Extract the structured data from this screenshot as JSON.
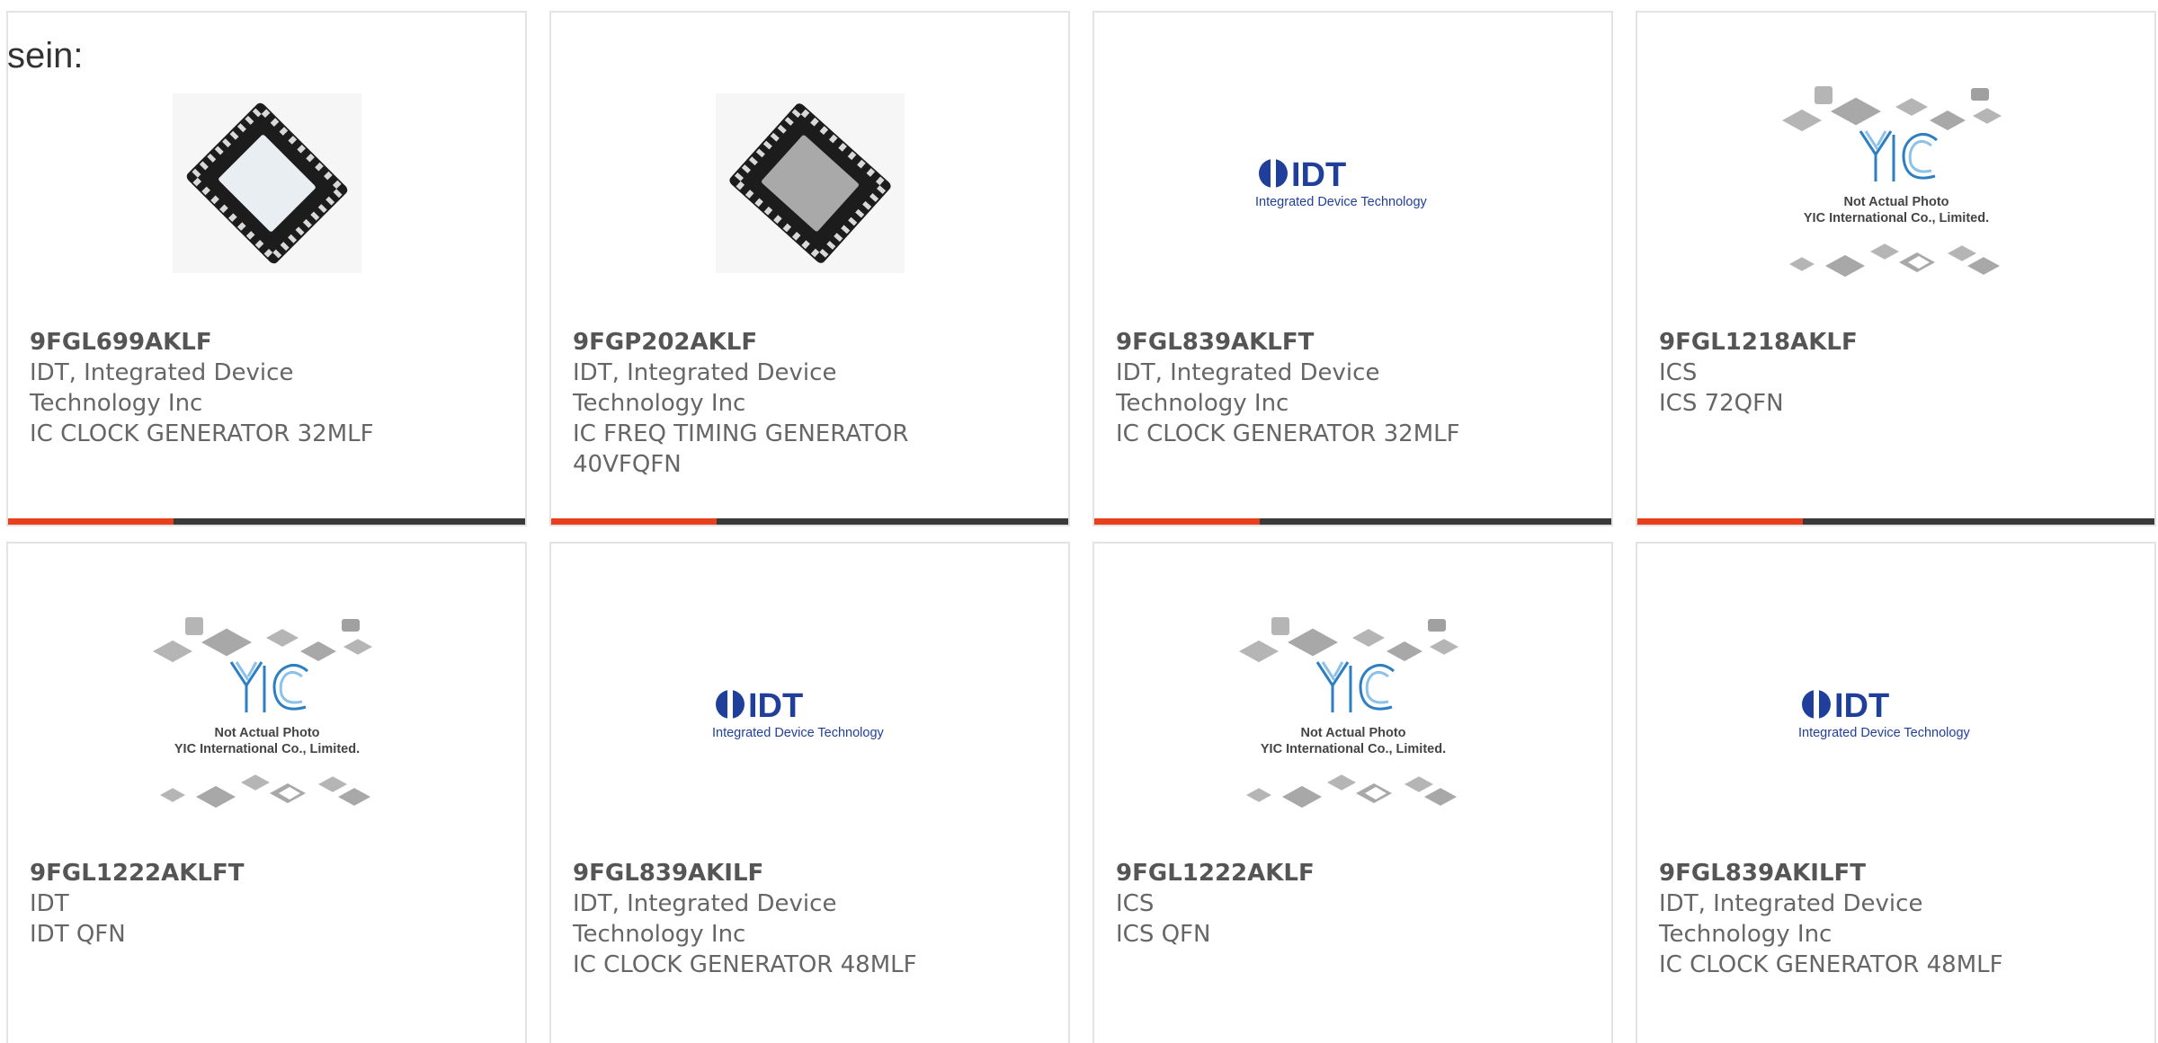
{
  "intro_text": "sein:",
  "colors": {
    "accent": "#e8401c",
    "bar_dark": "#3a3a3a",
    "card_border": "#e3e3e3",
    "idt_blue": "#1f3f9a"
  },
  "placeholder_image": {
    "line1": "Not Actual Photo",
    "line2": "YIC International Co., Limited."
  },
  "idt_logo": {
    "word": "IDT",
    "tagline": "Integrated Device Technology"
  },
  "cards": [
    {
      "image": "qfn-32-chip-photo",
      "part_number": "9FGL699AKLF",
      "manufacturer_lines": [
        "IDT, Integrated Device",
        "Technology Inc"
      ],
      "description_lines": [
        "IC CLOCK GENERATOR 32MLF"
      ],
      "hover_progress": 0.32
    },
    {
      "image": "vfqfn-40-chip-photo",
      "part_number": "9FGP202AKLF",
      "manufacturer_lines": [
        "IDT, Integrated Device",
        "Technology Inc"
      ],
      "description_lines": [
        "IC FREQ TIMING GENERATOR",
        "40VFQFN"
      ],
      "hover_progress": 0.32
    },
    {
      "image": "idt-logo",
      "part_number": "9FGL839AKLFT",
      "manufacturer_lines": [
        "IDT, Integrated Device",
        "Technology Inc"
      ],
      "description_lines": [
        "IC CLOCK GENERATOR 32MLF"
      ],
      "hover_progress": 0.32
    },
    {
      "image": "yic-placeholder",
      "part_number": "9FGL1218AKLF",
      "manufacturer_lines": [
        "ICS"
      ],
      "description_lines": [
        "ICS 72QFN"
      ],
      "hover_progress": 0.32
    },
    {
      "image": "yic-placeholder",
      "part_number": "9FGL1222AKLFT",
      "manufacturer_lines": [
        "IDT"
      ],
      "description_lines": [
        "IDT QFN"
      ]
    },
    {
      "image": "idt-logo",
      "part_number": "9FGL839AKILF",
      "manufacturer_lines": [
        "IDT, Integrated Device",
        "Technology Inc"
      ],
      "description_lines": [
        "IC CLOCK GENERATOR 48MLF"
      ]
    },
    {
      "image": "yic-placeholder",
      "part_number": "9FGL1222AKLF",
      "manufacturer_lines": [
        "ICS"
      ],
      "description_lines": [
        "ICS QFN"
      ]
    },
    {
      "image": "idt-logo",
      "part_number": "9FGL839AKILFT",
      "manufacturer_lines": [
        "IDT, Integrated Device",
        "Technology Inc"
      ],
      "description_lines": [
        "IC CLOCK GENERATOR 48MLF"
      ]
    }
  ]
}
